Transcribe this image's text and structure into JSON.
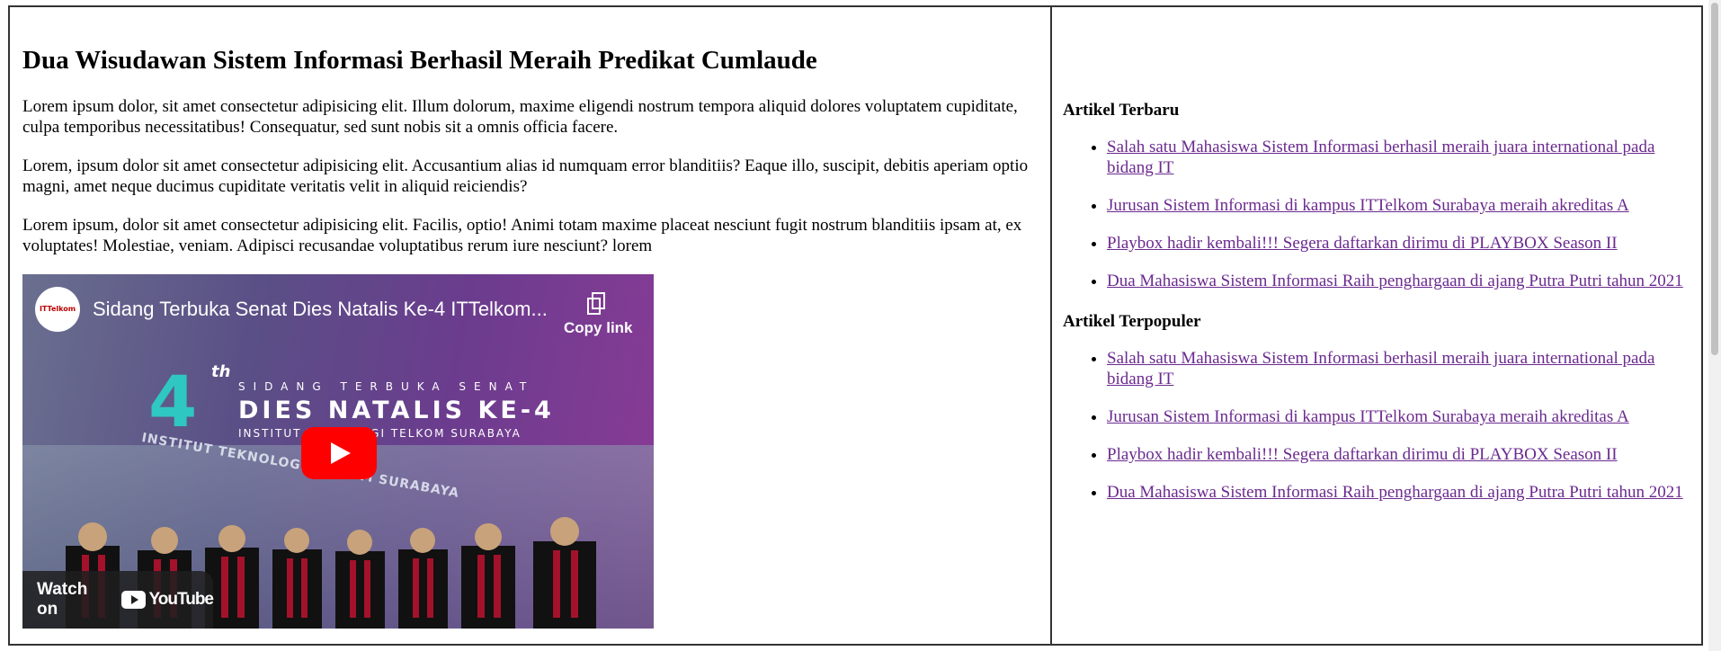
{
  "article": {
    "title": "Dua Wisudawan Sistem Informasi Berhasil Meraih Predikat Cumlaude",
    "paragraphs": [
      "Lorem ipsum dolor, sit amet consectetur adipisicing elit. Illum dolorum, maxime eligendi nostrum tempora aliquid dolores voluptatem cupiditate, culpa temporibus necessitatibus! Consequatur, sed sunt nobis sit a omnis officia facere.",
      "Lorem, ipsum dolor sit amet consectetur adipisicing elit. Accusantium alias id numquam error blanditiis? Eaque illo, suscipit, debitis aperiam optio magni, amet neque ducimus cupiditate veritatis velit in aliquid reiciendis?",
      "Lorem ipsum, dolor sit amet consectetur adipisicing elit. Facilis, optio! Animi totam maxime placeat nesciunt fugit nostrum blanditiis ipsam at, ex voluptates! Molestiae, veniam. Adipisci recusandae voluptatibus rerum iure nesciunt? lorem"
    ]
  },
  "video": {
    "title": "Sidang Terbuka Senat Dies Natalis Ke-4 ITTelkom...",
    "copy_link_label": "Copy link",
    "watch_on_label": "Watch on",
    "youtube_label": "YouTube",
    "thumb_line1": "SIDANG TERBUKA SENAT",
    "thumb_line2": "DIES NATALIS KE-4",
    "thumb_line3": "INSTITUT TEKNOLOGI TELKOM SURABAYA",
    "thumb_number": "4",
    "thumb_sup": "th",
    "building_text": "INSTITUT TEKNOLOGI TELKOM SURABAYA",
    "channel_logo_text": "ITTelkom"
  },
  "sidebar": {
    "latest_heading": "Artikel Terbaru",
    "latest": [
      "Salah satu Mahasiswa Sistem Informasi berhasil meraih juara international pada bidang IT",
      "Jurusan Sistem Informasi di kampus ITTelkom Surabaya meraih akreditas A",
      "Playbox hadir kembali!!! Segera daftarkan dirimu di PLAYBOX Season II",
      "Dua Mahasiswa Sistem Informasi Raih penghargaan di ajang Putra Putri tahun 2021"
    ],
    "popular_heading": "Artikel Terpopuler",
    "popular": [
      "Salah satu Mahasiswa Sistem Informasi berhasil meraih juara international pada bidang IT",
      "Jurusan Sistem Informasi di kampus ITTelkom Surabaya meraih akreditas A",
      "Playbox hadir kembali!!! Segera daftarkan dirimu di PLAYBOX Season II",
      "Dua Mahasiswa Sistem Informasi Raih penghargaan di ajang Putra Putri tahun 2021"
    ]
  },
  "colors": {
    "link": "#6b2a8f",
    "border": "#333333",
    "youtube_red": "#ff0000"
  }
}
